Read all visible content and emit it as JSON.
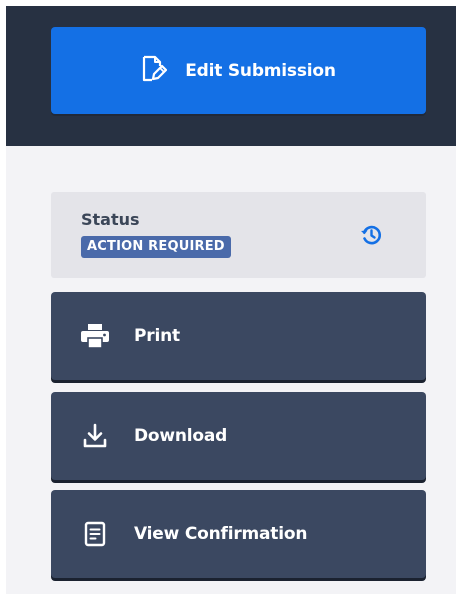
{
  "header": {
    "edit_button": {
      "label": "Edit Submission",
      "icon": "edit-document-icon"
    }
  },
  "status": {
    "title": "Status",
    "badge": "ACTION REQUIRED",
    "history_icon": "history-icon"
  },
  "actions": [
    {
      "label": "Print",
      "icon": "printer-icon"
    },
    {
      "label": "Download",
      "icon": "download-icon"
    },
    {
      "label": "View Confirmation",
      "icon": "document-icon"
    }
  ],
  "colors": {
    "dark_band": "#273142",
    "primary": "#1470e5",
    "action_button": "#3b4861",
    "panel": "#f3f3f6",
    "status_bg": "#e4e4e9",
    "badge": "#4a6aaa",
    "history_icon": "#1470e5"
  }
}
